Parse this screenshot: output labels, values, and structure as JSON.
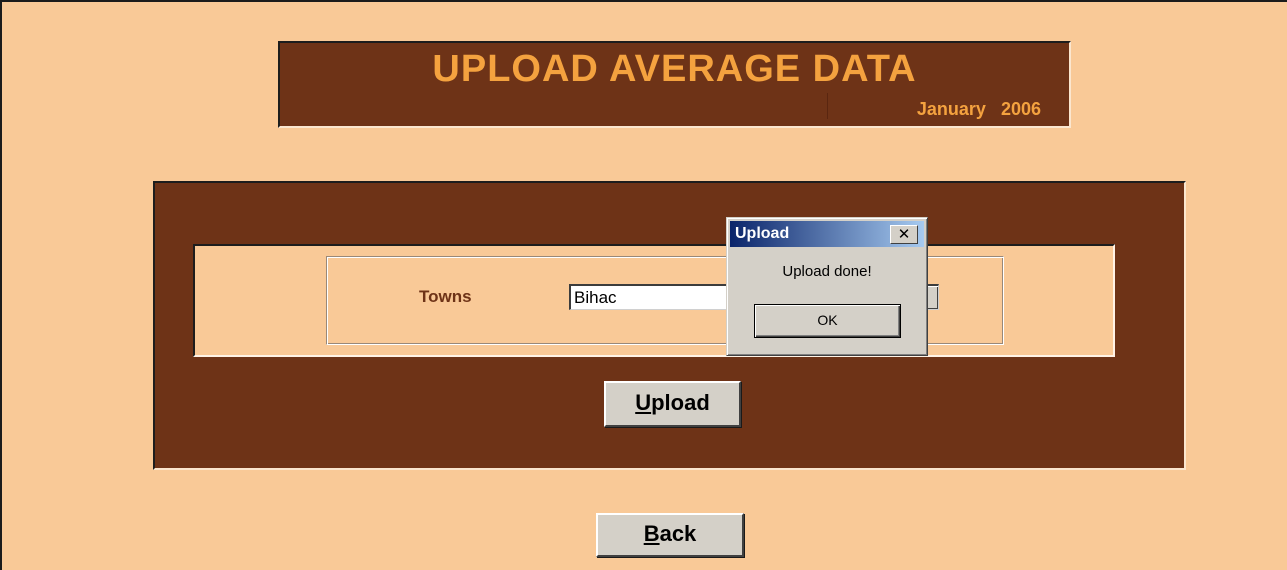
{
  "header": {
    "title": "UPLOAD AVERAGE DATA",
    "month": "January",
    "year": "2006"
  },
  "form": {
    "towns_label": "Towns",
    "towns_value": "Bihac"
  },
  "buttons": {
    "upload_label": "Upload",
    "upload_mnemonic": "U",
    "upload_rest": "pload",
    "back_label": "Back",
    "back_mnemonic": "B",
    "back_rest": "ack"
  },
  "dialog": {
    "title": "Upload",
    "message": "Upload done!",
    "ok_label": "OK",
    "close_icon": "close-icon"
  },
  "colors": {
    "background": "#f9c997",
    "panel_brown": "#6e3317",
    "title_orange": "#f4a23f",
    "button_face": "#d4d0c8",
    "titlebar_start": "#0a246a",
    "titlebar_end": "#a6caf0"
  }
}
